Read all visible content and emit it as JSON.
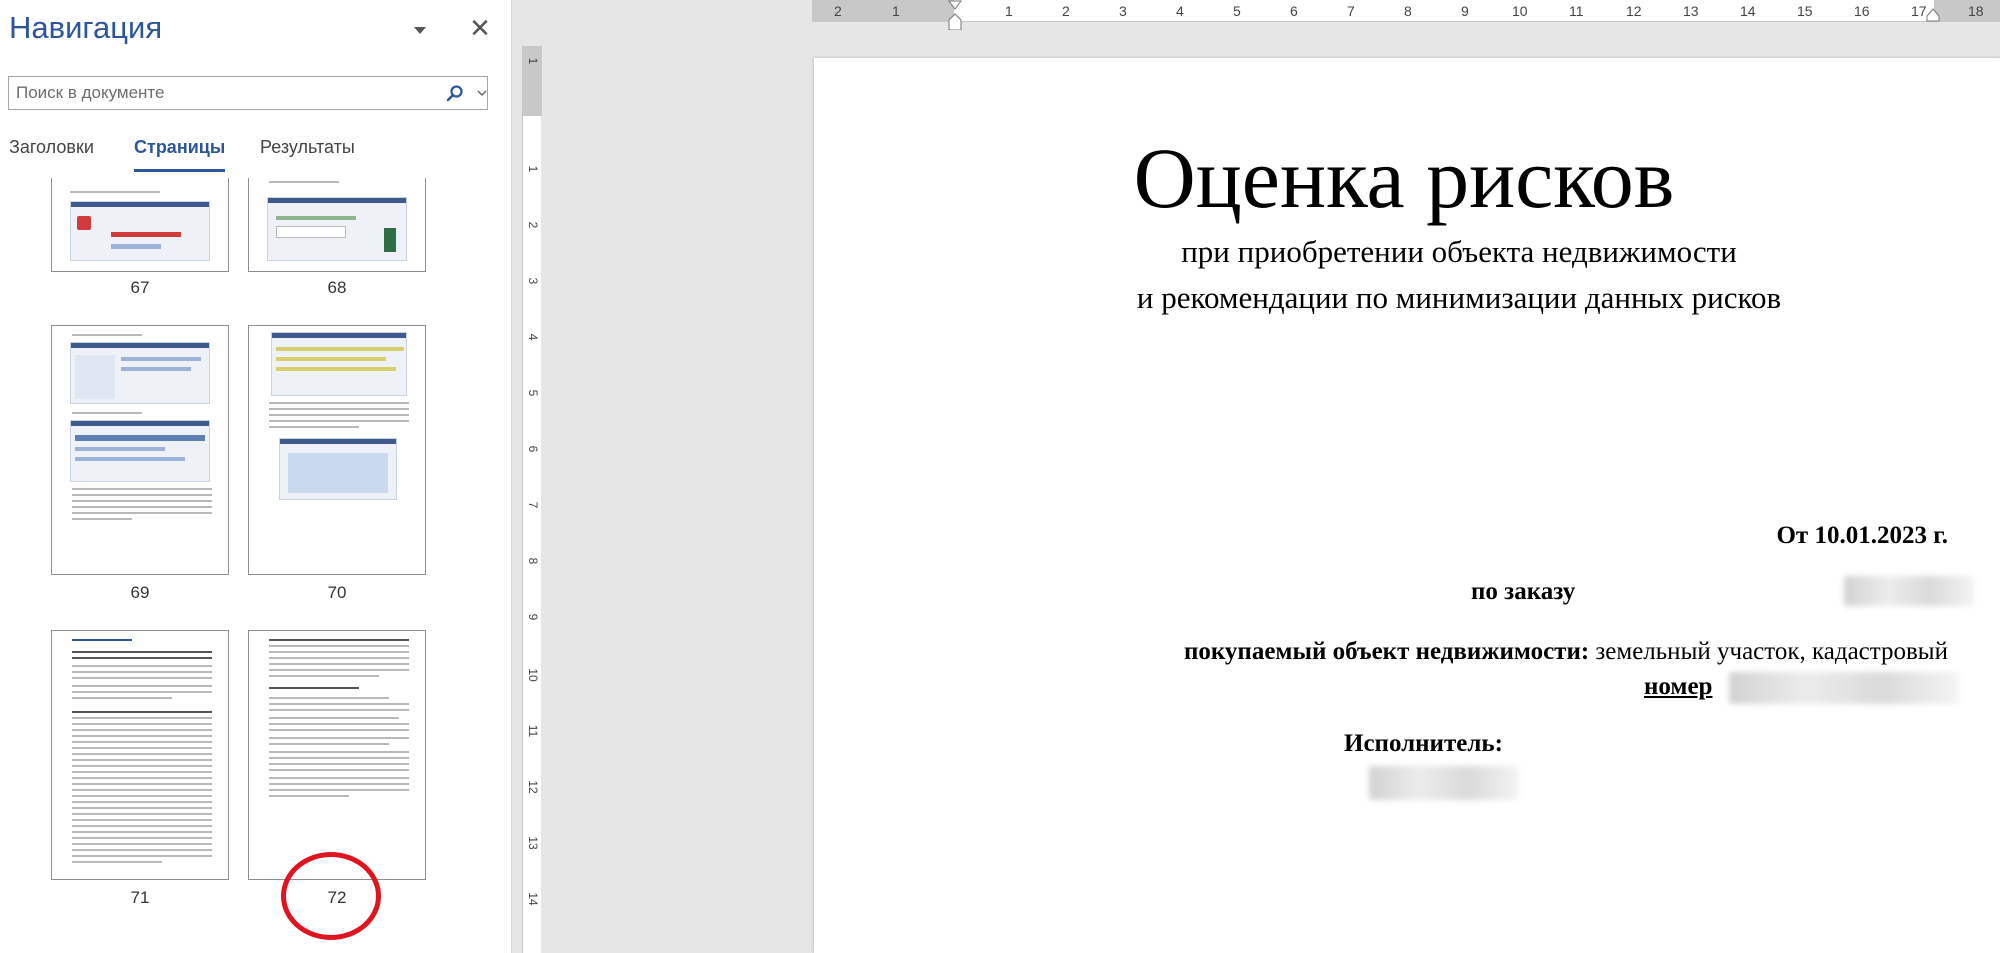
{
  "nav_pane": {
    "title": "Навигация",
    "close_glyph": "✕",
    "search": {
      "placeholder": "Поиск в документе",
      "value": ""
    },
    "tabs": [
      {
        "label": "Заголовки",
        "active": false
      },
      {
        "label": "Страницы",
        "active": true
      },
      {
        "label": "Результаты",
        "active": false
      }
    ],
    "thumbnails": [
      {
        "page": "67"
      },
      {
        "page": "68"
      },
      {
        "page": "69"
      },
      {
        "page": "70"
      },
      {
        "page": "71"
      },
      {
        "page": "72",
        "highlighted": true
      }
    ]
  },
  "ruler": {
    "corner_glyph": "L",
    "horizontal_labels": [
      "2",
      "1",
      "1",
      "2",
      "3",
      "4",
      "5",
      "6",
      "7",
      "8",
      "9",
      "10",
      "11",
      "12",
      "13",
      "14",
      "15",
      "16",
      "17",
      "18"
    ],
    "vertical_labels": [
      "1",
      "1",
      "2",
      "3",
      "4",
      "5",
      "6",
      "7",
      "8",
      "9",
      "10",
      "11",
      "12",
      "13",
      "14"
    ]
  },
  "document": {
    "title": "Оценка рисков",
    "subtitle_line1": "при приобретении объекта недвижимости",
    "subtitle_line2": "и рекомендации по минимизации данных рисков",
    "date": "От 10.01.2023 г.",
    "order_label": "по заказу",
    "object_label": "покупаемый объект недвижимости:",
    "object_value": "земельный участок, кадастровый",
    "number_label": "номер",
    "executor_label": "Исполнитель:"
  },
  "colors": {
    "accent": "#2b579a",
    "highlight_circle": "#e0141e"
  },
  "icons": {
    "nav_menu": "chevron-down-icon",
    "close": "close-icon",
    "search": "search-icon",
    "search_options": "chevron-down-icon"
  }
}
